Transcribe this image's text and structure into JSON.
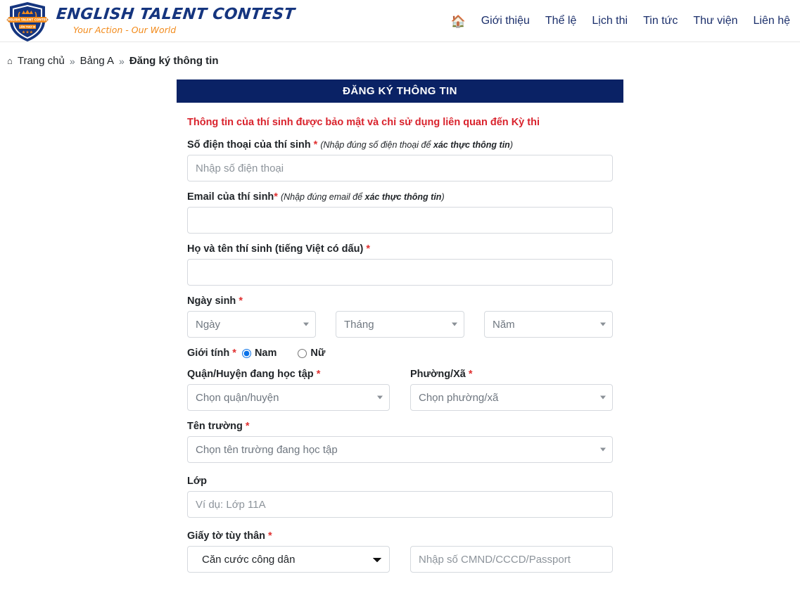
{
  "header": {
    "logo_icon": "shield-badge-logo",
    "logo_ribbon_text": "ENGLISH TALENT CONTEST",
    "logo_edition_text": "LẦN THỨ III",
    "brand_title": "ENGLISH TALENT CONTEST",
    "brand_tagline": "Your Action - Our World",
    "home_icon": "home-icon",
    "nav_items": [
      {
        "label": "Giới thiệu"
      },
      {
        "label": "Thể lệ"
      },
      {
        "label": "Lịch thi"
      },
      {
        "label": "Tin tức"
      },
      {
        "label": "Thư viện"
      },
      {
        "label": "Liên hệ"
      }
    ]
  },
  "breadcrumb": {
    "home_icon": "home-icon",
    "items": [
      {
        "label": "Trang chủ",
        "current": false
      },
      {
        "label": "Bảng A",
        "current": false
      },
      {
        "label": "Đăng ký thông tin",
        "current": true
      }
    ],
    "separator": "»"
  },
  "form": {
    "title": "ĐĂNG KÝ THÔNG TIN",
    "notice": "Thông tin của thí sinh được bảo mật và chỉ sử dụng liên quan đến Kỳ thi",
    "required_mark": "*",
    "phone": {
      "label": "Số điện thoại của thí sinh",
      "hint_pre": "(Nhập đúng số điện thoại để ",
      "hint_bold": "xác thực thông tin",
      "hint_post": ")",
      "placeholder": "Nhập số điện thoại",
      "value": ""
    },
    "email": {
      "label": "Email của thí sinh",
      "hint_pre": "(Nhập đúng email để ",
      "hint_bold": "xác thực thông tin",
      "hint_post": ")",
      "placeholder": "",
      "value": ""
    },
    "fullname": {
      "label": "Họ và tên thí sinh (tiếng Việt có dấu)",
      "placeholder": "",
      "value": ""
    },
    "dob": {
      "label": "Ngày sinh",
      "day": {
        "selected": "Ngày"
      },
      "month": {
        "selected": "Tháng"
      },
      "year": {
        "selected": "Năm"
      }
    },
    "gender": {
      "label": "Giới tính",
      "options": [
        {
          "label": "Nam",
          "checked": true
        },
        {
          "label": "Nữ",
          "checked": false
        }
      ]
    },
    "district": {
      "label": "Quận/Huyện đang học tập",
      "selected": "Chọn quận/huyện"
    },
    "ward": {
      "label": "Phường/Xã",
      "selected": "Chọn phường/xã"
    },
    "school": {
      "label": "Tên trường",
      "selected": "Chọn tên trường đang học tập"
    },
    "classroom": {
      "label": "Lớp",
      "placeholder": "Ví dụ: Lớp 11A",
      "value": ""
    },
    "identity": {
      "label": "Giấy tờ tùy thân",
      "doc_type_selected": "Căn cước công dân",
      "doc_number_placeholder": "Nhập số CMND/CCCD/Passport",
      "doc_number_value": ""
    }
  },
  "colors": {
    "brand_navy": "#15357f",
    "header_navy": "#0a2265",
    "brand_orange": "#f28a1a",
    "notice_red": "#d9232d",
    "required_red": "#e03131"
  }
}
